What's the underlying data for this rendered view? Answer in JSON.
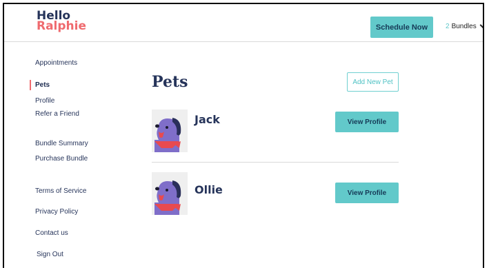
{
  "brand": {
    "line1": "Hello",
    "line2": "Ralphie"
  },
  "header": {
    "schedule_label": "Schedule Now",
    "bundles_count": "2",
    "bundles_label": "Bundles"
  },
  "sidebar": {
    "items": [
      {
        "label": "Appointments",
        "active": false
      },
      {
        "label": "Pets",
        "active": true
      },
      {
        "label": "Profile",
        "active": false
      },
      {
        "label": "Refer a Friend",
        "active": false
      },
      {
        "label": "Bundle Summary",
        "active": false
      },
      {
        "label": "Purchase Bundle",
        "active": false
      },
      {
        "label": "Terms of Service",
        "active": false
      },
      {
        "label": "Privacy Policy",
        "active": false
      },
      {
        "label": "Contact us",
        "active": false
      },
      {
        "label": "Sign Out",
        "active": false
      }
    ]
  },
  "main": {
    "title": "Pets",
    "add_label": "Add New Pet",
    "pets": [
      {
        "name": "Jack",
        "button": "View Profile"
      },
      {
        "name": "Ollie",
        "button": "View Profile"
      }
    ]
  },
  "colors": {
    "accent": "#62c9ca",
    "brand_navy": "#26345a",
    "brand_coral": "#ef6a6e",
    "dog_purple": "#7f6ec9",
    "bandana_red": "#e84a4f"
  }
}
